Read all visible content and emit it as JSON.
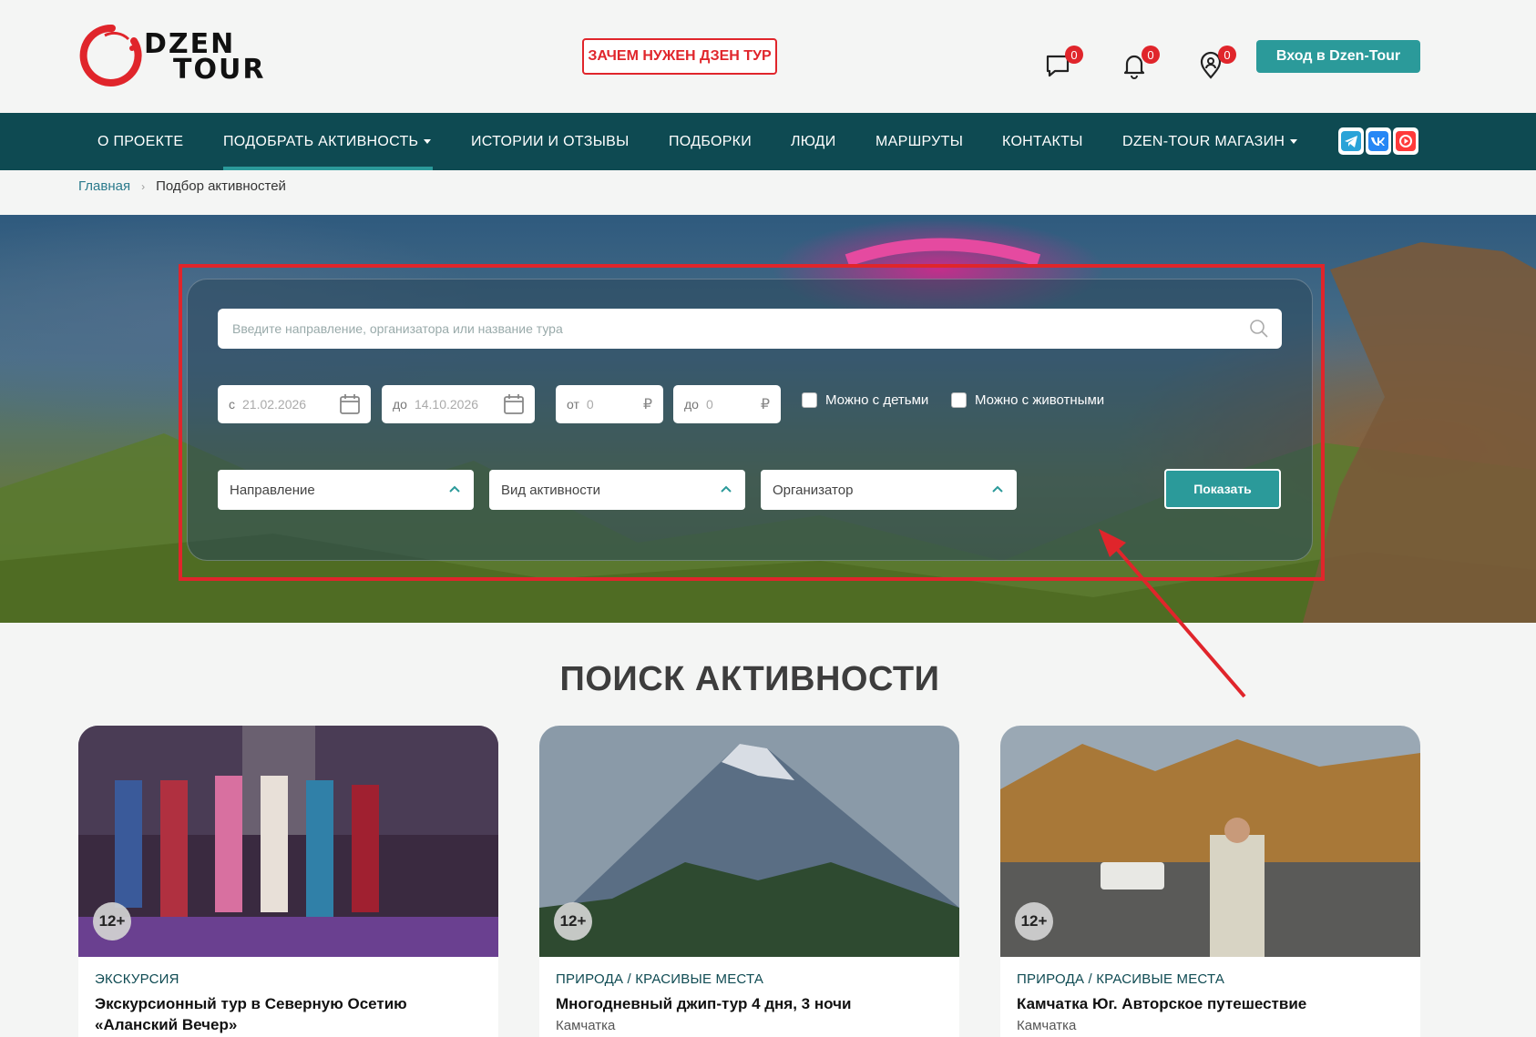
{
  "header": {
    "why_label": "ЗАЧЕМ НУЖЕН ДЗЕН ТУР",
    "login_label": "Вход в Dzen-Tour",
    "icons": [
      {
        "name": "messages",
        "count": "0"
      },
      {
        "name": "notifications",
        "count": "0"
      },
      {
        "name": "location",
        "count": "0"
      }
    ],
    "logo_line1": "DZEN",
    "logo_line2": "TOUR"
  },
  "nav": {
    "items": [
      {
        "label": "О ПРОЕКТЕ"
      },
      {
        "label": "ПОДОБРАТЬ АКТИВНОСТЬ"
      },
      {
        "label": "ИСТОРИИ И ОТЗЫВЫ"
      },
      {
        "label": "ПОДБОРКИ"
      },
      {
        "label": "ЛЮДИ"
      },
      {
        "label": "МАРШРУТЫ"
      },
      {
        "label": "КОНТАКТЫ"
      },
      {
        "label": "DZEN-TOUR МАГАЗИН"
      }
    ],
    "socials": [
      "telegram-icon",
      "vk-icon",
      "video-icon"
    ]
  },
  "breadcrumb": {
    "home": "Главная",
    "current": "Подбор активностей"
  },
  "filters": {
    "search_placeholder": "Введите направление, организатора или название тура",
    "date_from_prefix": "с",
    "date_from": "21.02.2026",
    "date_to_prefix": "до",
    "date_to": "14.10.2026",
    "price_from_prefix": "от",
    "price_from": "0",
    "price_to_prefix": "до",
    "price_to": "0",
    "currency": "₽",
    "with_kids": "Можно с детьми",
    "with_pets": "Можно с животными",
    "direction": "Направление",
    "activity_type": "Вид активности",
    "organizer": "Организатор",
    "show_button": "Показать"
  },
  "section": {
    "title": "ПОИСК АКТИВНОСТИ"
  },
  "cards": [
    {
      "age": "12+",
      "category": "ЭКСКУРСИЯ",
      "title": "Экскурсионный тур в Северную Осетию «Аланский Вечер»",
      "place": ""
    },
    {
      "age": "12+",
      "category": "ПРИРОДА / КРАСИВЫЕ МЕСТА",
      "title": "Многодневный джип-тур 4 дня, 3 ночи",
      "place": "Камчатка"
    },
    {
      "age": "12+",
      "category": "ПРИРОДА / КРАСИВЫЕ МЕСТА",
      "title": "Камчатка Юг. Авторское путешествие",
      "place": "Камчатка"
    }
  ],
  "colors": {
    "accent": "#2b9a9a",
    "nav_bg": "#0e4a52",
    "brand_red": "#e0252b"
  }
}
